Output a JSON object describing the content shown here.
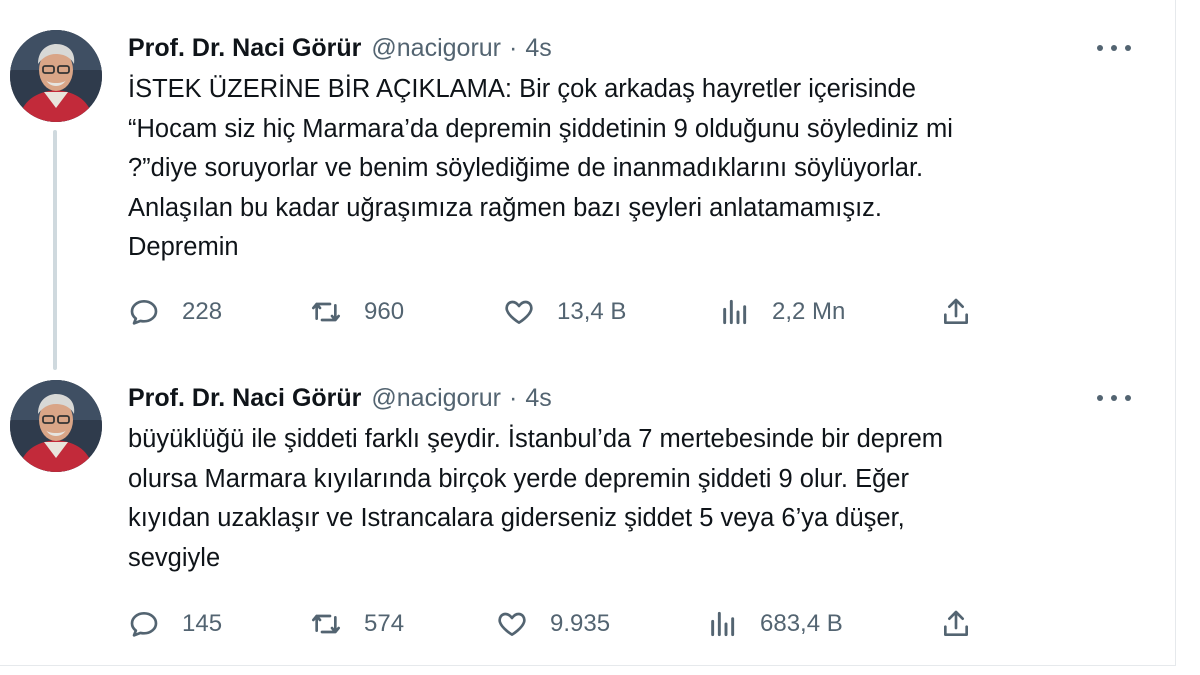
{
  "tweets": [
    {
      "author_name": "Prof. Dr. Naci Görür",
      "handle": "@nacigorur",
      "separator": "·",
      "time": "4s",
      "text_lines": [
        "İSTEK ÜZERİNE BİR AÇIKLAMA: Bir çok arkadaş hayretler içerisinde",
        "“Hocam siz hiç Marmara’da depremin şiddetinin 9 olduğunu söylediniz mi",
        "?”diye soruyorlar ve benim söylediğime de inanmadıklarını söylüyorlar.",
        "Anlaşılan bu kadar uğraşımıza rağmen bazı şeyleri anlatamamışız.",
        "Depremin"
      ],
      "replies": "228",
      "retweets": "960",
      "likes": "13,4 B",
      "views": "2,2 Mn"
    },
    {
      "author_name": "Prof. Dr. Naci Görür",
      "handle": "@nacigorur",
      "separator": "·",
      "time": "4s",
      "text_lines": [
        "büyüklüğü ile şiddeti farklı şeydir. İstanbul’da 7 mertebesinde bir deprem",
        "olursa Marmara kıyılarında birçok yerde depremin şiddeti 9 olur. Eğer",
        "kıyıdan uzaklaşır ve Istrancalara giderseniz şiddet 5 veya 6’ya düşer,",
        "sevgiyle"
      ],
      "replies": "145",
      "retweets": "574",
      "likes": "9.935",
      "views": "683,4 B"
    }
  ],
  "icons": {
    "reply": "reply-icon",
    "retweet": "retweet-icon",
    "like": "like-icon",
    "views": "views-icon",
    "share": "share-icon",
    "more": "more-icon"
  },
  "colors": {
    "text": "#0f1419",
    "secondary": "#536471",
    "thread_line": "#cfd9de"
  }
}
